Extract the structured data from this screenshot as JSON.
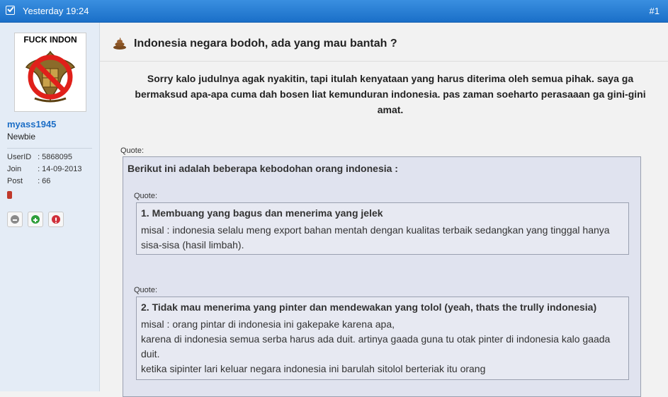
{
  "header": {
    "timestamp": "Yesterday 19:24",
    "post_number": "#1"
  },
  "user": {
    "avatar_text": "FUCK INDON",
    "avatar_emblem_text": "BHINNEKA TUNGGAL IKA",
    "username": "myass1945",
    "rank": "Newbie",
    "info": [
      {
        "key": "UserID",
        "value": ": 5868095"
      },
      {
        "key": "Join",
        "value": ": 14-09-2013"
      },
      {
        "key": "Post",
        "value": ": 66"
      }
    ],
    "actions": [
      {
        "name": "profile-button",
        "icon": "minus-circle-icon",
        "color": "#8a8a8a"
      },
      {
        "name": "reputation-button",
        "icon": "plus-circle-icon",
        "color": "#2e9e3a"
      },
      {
        "name": "report-button",
        "icon": "exclamation-icon",
        "color": "#d0303a"
      }
    ]
  },
  "post": {
    "title_icon": "poop-icon",
    "title": "Indonesia negara bodoh, ada yang mau bantah ?",
    "intro": "Sorry kalo judulnya agak nyakitin, tapi itulah kenyataan yang harus diterima oleh semua pihak. saya ga bermaksud apa-apa cuma dah bosen liat kemunduran indonesia. pas zaman soeharto perasaaan ga gini-gini amat.",
    "quote_label": "Quote:",
    "outer_quote_lead": "Berikut ini adalah beberapa kebodohan orang indonesia :",
    "inner_quotes": [
      {
        "label": "Quote:",
        "heading": "1. Membuang yang bagus dan menerima yang jelek",
        "body": "misal : indonesia selalu meng export bahan mentah dengan kualitas terbaik sedangkan yang tinggal hanya sisa-sisa (hasil limbah)."
      },
      {
        "label": "Quote:",
        "heading": "2. Tidak mau menerima yang pinter dan mendewakan yang tolol (yeah, thats the trully indonesia)",
        "body_lines": [
          "misal : orang pintar di indonesia ini gakepake karena apa,",
          "karena di indonesia semua serba harus ada duit. artinya gaada guna tu otak pinter di indonesia kalo gaada duit.",
          "ketika sipinter lari keluar negara indonesia ini barulah sitolol berteriak itu orang"
        ]
      }
    ]
  }
}
